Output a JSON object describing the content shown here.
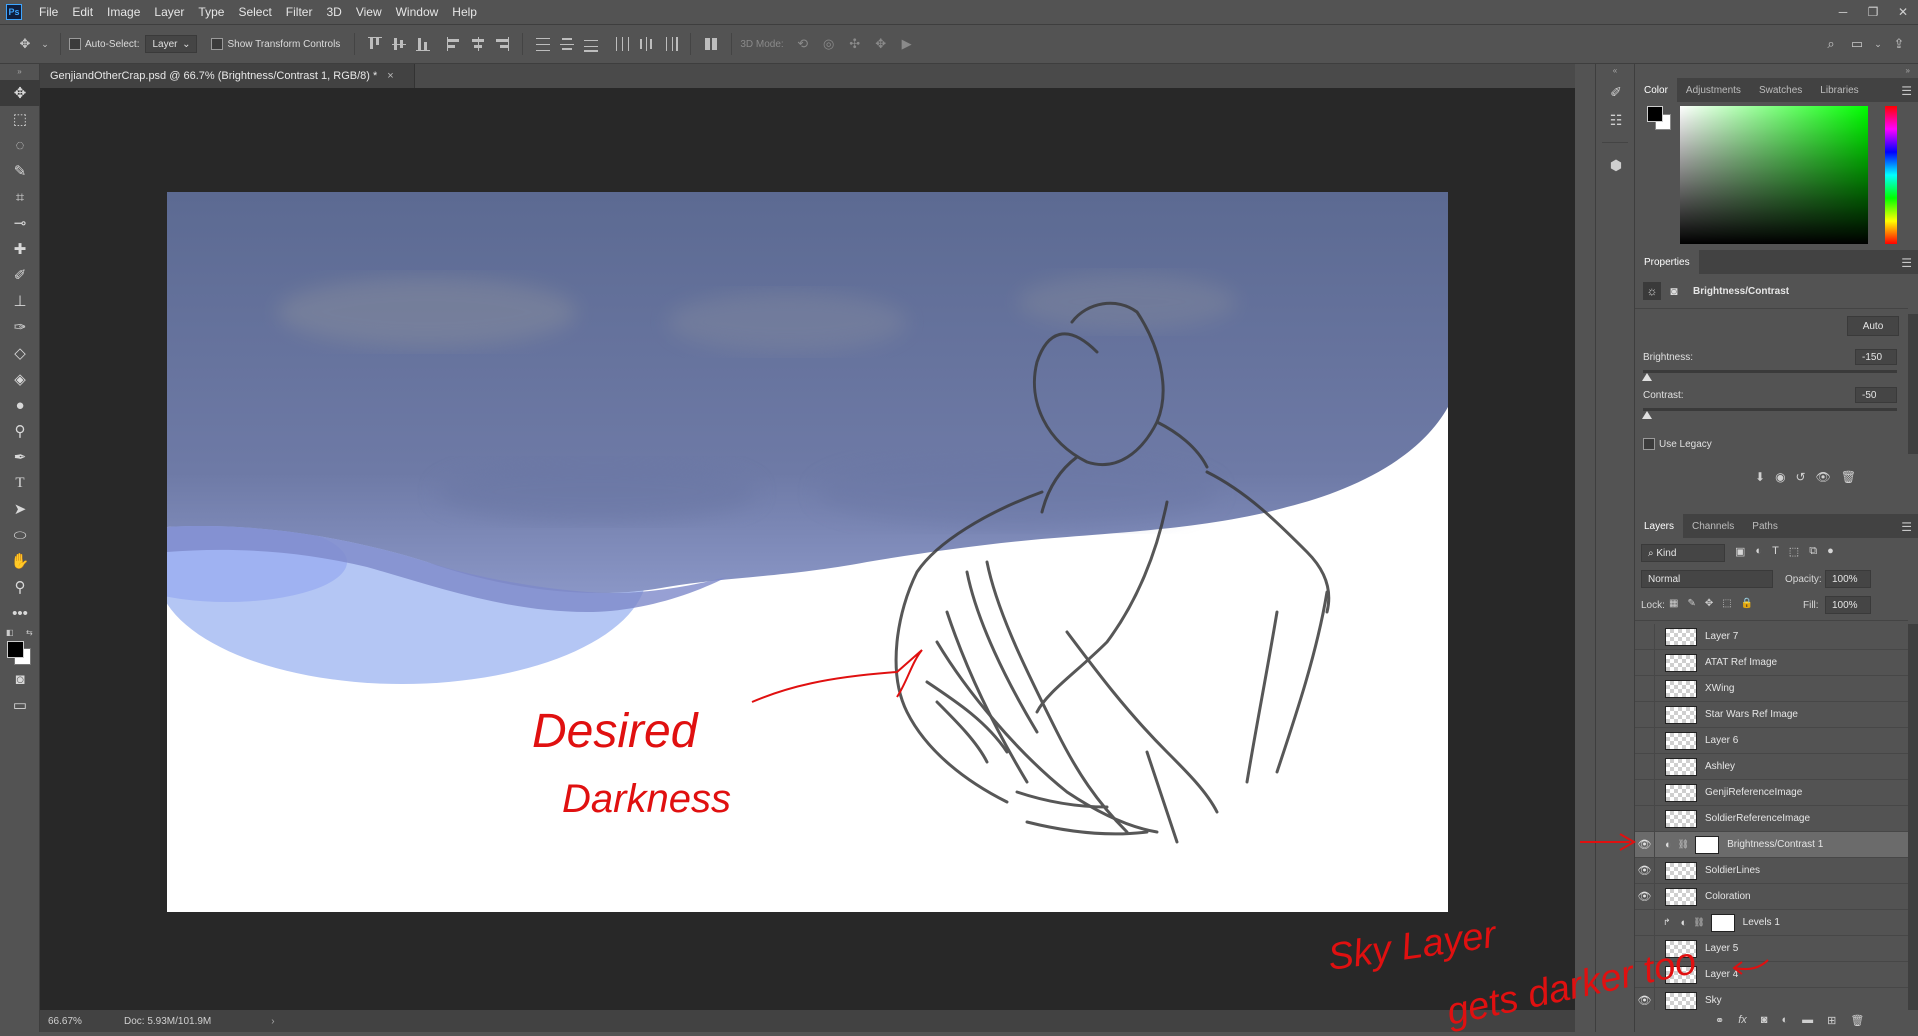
{
  "menubar": {
    "logo": "Ps",
    "items": [
      "File",
      "Edit",
      "Image",
      "Layer",
      "Type",
      "Select",
      "Filter",
      "3D",
      "View",
      "Window",
      "Help"
    ]
  },
  "options": {
    "auto_select_label": "Auto-Select:",
    "auto_select_value": "Layer",
    "transform_label": "Show Transform Controls",
    "mode3d_label": "3D Mode:"
  },
  "document": {
    "tab_title": "GenjiandOtherCrap.psd @ 66.7% (Brightness/Contrast 1, RGB/8) *",
    "close_glyph": "×",
    "zoom": "66.67%",
    "doc_size": "Doc: 5.93M/101.9M",
    "annotations": {
      "canvas_text_1": "Desired",
      "canvas_text_2": "Darkness",
      "layers_note_1": "Sky Layer",
      "layers_note_2": "gets darker too"
    }
  },
  "color_panel": {
    "tabs": [
      "Color",
      "Adjustments",
      "Swatches",
      "Libraries"
    ],
    "active_tab": "Color"
  },
  "properties": {
    "tab": "Properties",
    "adjustment_name": "Brightness/Contrast",
    "auto_button": "Auto",
    "brightness_label": "Brightness:",
    "brightness_value": "-150",
    "brightness_fraction": 0.0,
    "contrast_label": "Contrast:",
    "contrast_value": "-50",
    "contrast_fraction": 0.0,
    "legacy_label": "Use Legacy"
  },
  "layers_panel": {
    "tabs": [
      "Layers",
      "Channels",
      "Paths"
    ],
    "active_tab": "Layers",
    "kind_filter": "Kind",
    "blend_mode": "Normal",
    "opacity_label": "Opacity:",
    "opacity_value": "100%",
    "lock_label": "Lock:",
    "fill_label": "Fill:",
    "fill_value": "100%",
    "layers": [
      {
        "name": "Layer 7",
        "visible": false
      },
      {
        "name": "ATAT Ref Image",
        "visible": false
      },
      {
        "name": "XWing",
        "visible": false
      },
      {
        "name": "Star Wars Ref Image",
        "visible": false
      },
      {
        "name": "Layer 6",
        "visible": false
      },
      {
        "name": "Ashley",
        "visible": false
      },
      {
        "name": "GenjiReferenceImage",
        "visible": false
      },
      {
        "name": "SoldierReferenceImage",
        "visible": false
      },
      {
        "name": "Brightness/Contrast 1",
        "visible": true,
        "selected": true,
        "adjustment": true
      },
      {
        "name": "SoldierLines",
        "visible": true
      },
      {
        "name": "Coloration",
        "visible": true
      },
      {
        "name": "Levels 1",
        "visible": false,
        "adjustment": true,
        "clipped": true
      },
      {
        "name": "Layer 5",
        "visible": false
      },
      {
        "name": "Layer 4",
        "visible": false
      },
      {
        "name": "Sky",
        "visible": true
      }
    ]
  },
  "icons": {
    "eye": "👁",
    "move": "move-tool-icon",
    "fx": "fx"
  },
  "colors": {
    "annotation_red": "#e01010",
    "sky_blue": "#5e6d98",
    "selected_row": "#6b6b6b"
  }
}
